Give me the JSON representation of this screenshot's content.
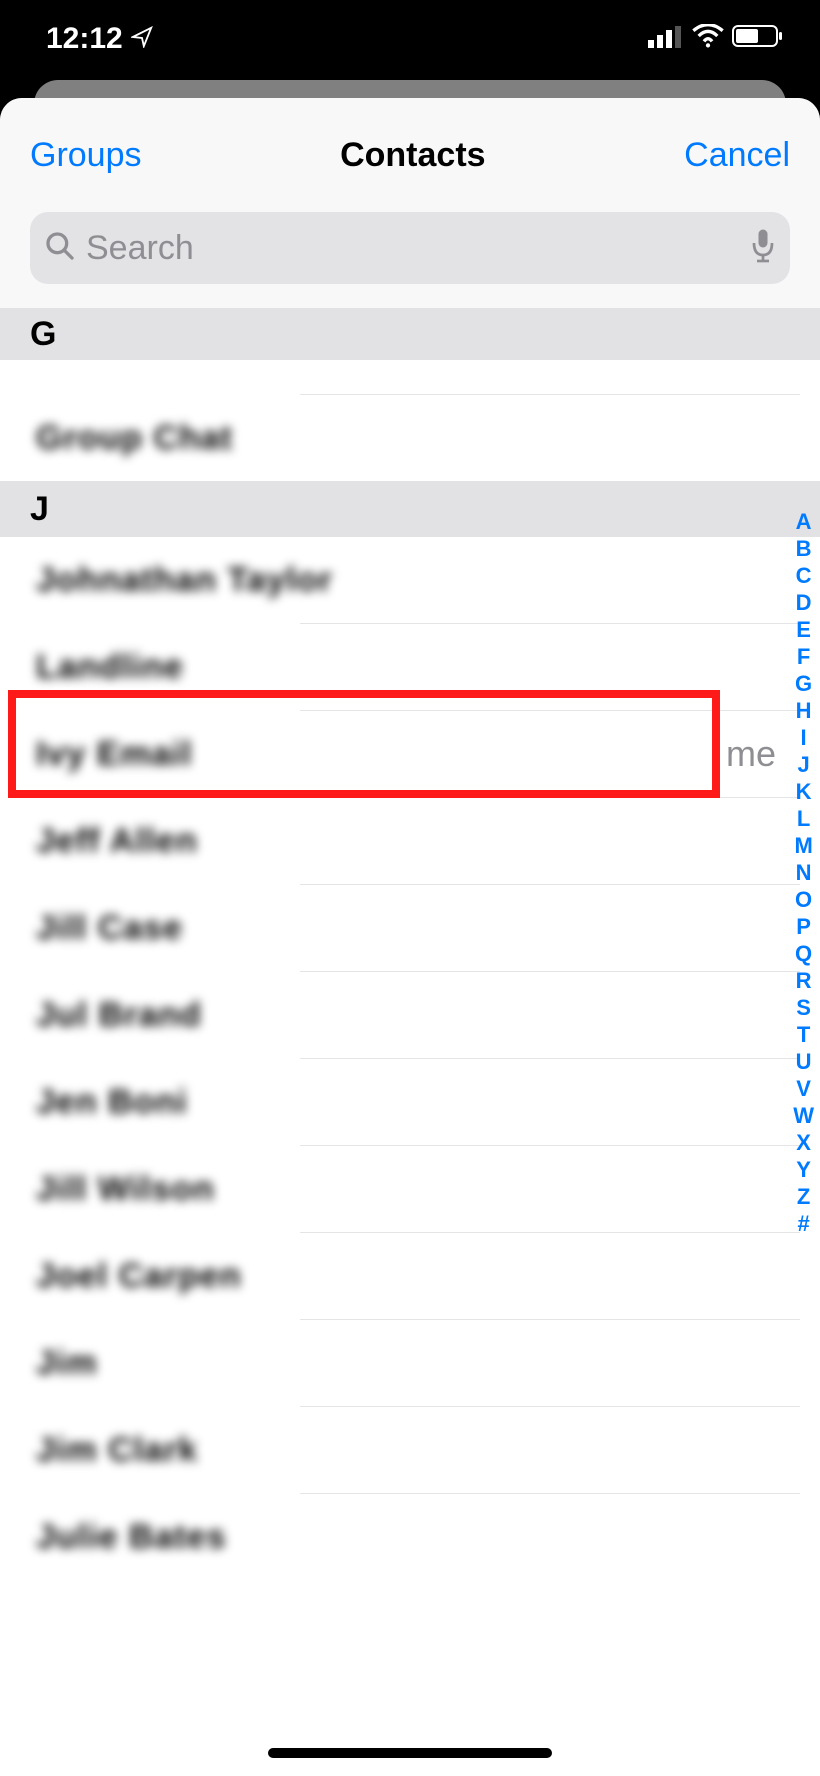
{
  "status": {
    "time": "12:12"
  },
  "nav": {
    "left": "Groups",
    "title": "Contacts",
    "right": "Cancel"
  },
  "search": {
    "placeholder": "Search"
  },
  "pinnedHeader": "G",
  "sectionHeader": "J",
  "rowPartial": " ",
  "rows": [
    {
      "t": "Group Chat"
    },
    {
      "t": "Johnathan Taylor"
    },
    {
      "t": "Landline"
    },
    {
      "t": "Ivy Email",
      "me": "me"
    },
    {
      "t": "Jeff Allen"
    },
    {
      "t": "Jill Case"
    },
    {
      "t": "Jul Brand"
    },
    {
      "t": "Jen Boni"
    },
    {
      "t": "Jill Wilson"
    },
    {
      "t": "Joel Carpen"
    },
    {
      "t": "Jim"
    },
    {
      "t": "Jim Clark"
    },
    {
      "t": "Julie Bates"
    }
  ],
  "index": [
    "A",
    "B",
    "C",
    "D",
    "E",
    "F",
    "G",
    "H",
    "I",
    "J",
    "K",
    "L",
    "M",
    "N",
    "O",
    "P",
    "Q",
    "R",
    "S",
    "T",
    "U",
    "V",
    "W",
    "X",
    "Y",
    "Z",
    "#"
  ]
}
